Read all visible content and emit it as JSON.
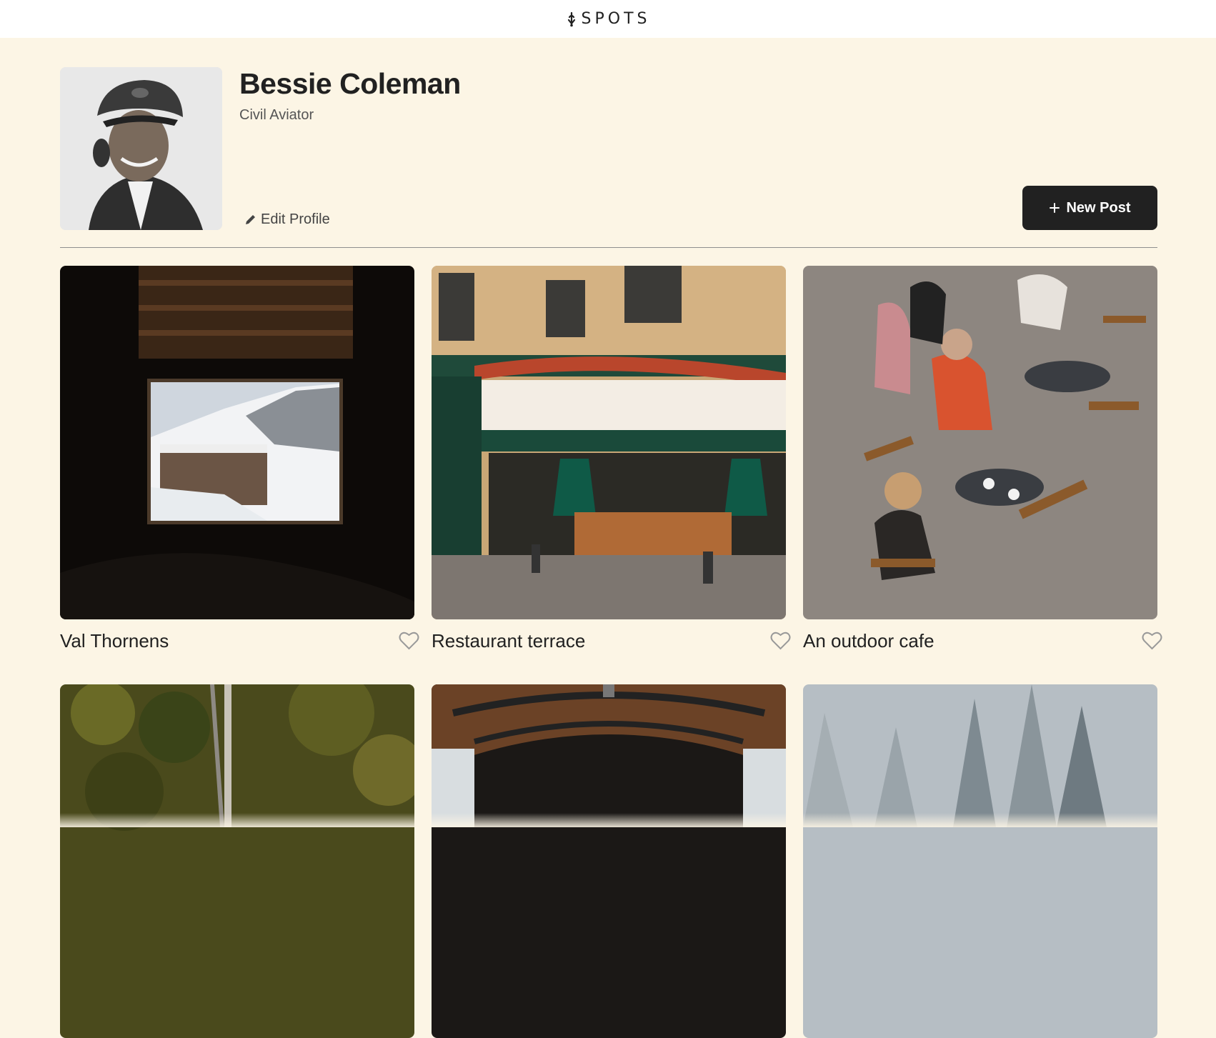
{
  "header": {
    "logo_text": "SPOTS"
  },
  "profile": {
    "name": "Bessie Coleman",
    "job": "Civil Aviator",
    "edit_label": "Edit Profile",
    "new_post_label": "New Post"
  },
  "cards": [
    {
      "title": "Val Thornens"
    },
    {
      "title": "Restaurant terrace"
    },
    {
      "title": "An outdoor cafe"
    },
    {
      "title": ""
    },
    {
      "title": ""
    },
    {
      "title": ""
    }
  ],
  "colors": {
    "background": "#fcf5e5",
    "button": "#212121",
    "text": "#212121"
  },
  "icons": [
    "spots-logo-icon",
    "pencil-icon",
    "plus-icon",
    "heart-icon"
  ]
}
